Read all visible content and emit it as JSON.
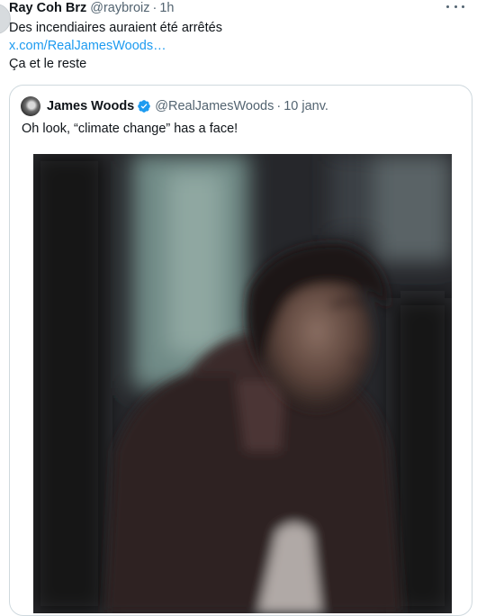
{
  "tweet": {
    "author_name": "Ray Coh Brz",
    "author_handle": "@raybroiz",
    "separator": "·",
    "time": "1h",
    "more_icon": "more-horizontal-icon",
    "text_line1": "Des incendiaires auraient été arrêtés",
    "link_text": "x.com/RealJamesWoods…",
    "text_line3": "Ça et le reste"
  },
  "quote": {
    "author_name": "James Woods",
    "verified_icon": "verified-badge-icon",
    "author_handle": "@RealJamesWoods",
    "separator": "·",
    "time": "10 janv.",
    "text": "Oh look, “climate change” has a face!"
  },
  "colors": {
    "link": "#1d9bf0",
    "secondary_text": "#536471",
    "border": "#cfd9de",
    "verified": "#1d9bf0"
  }
}
